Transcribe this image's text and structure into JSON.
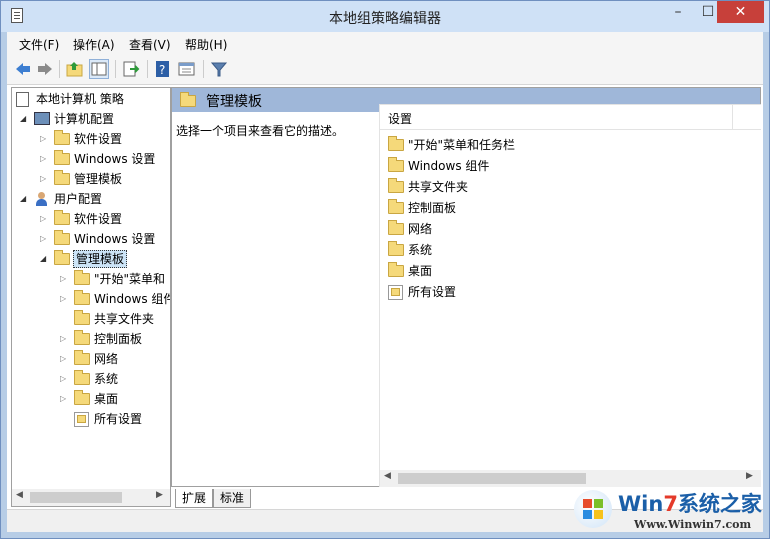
{
  "window": {
    "title": "本地组策略编辑器",
    "minimize": "–",
    "maximize": "☐",
    "close": "✕"
  },
  "menu": [
    "文件(F)",
    "操作(A)",
    "查看(V)",
    "帮助(H)"
  ],
  "toolbar": [
    "back-icon",
    "forward-icon",
    "up-folder-icon",
    "show-hide-tree-icon",
    "export-list-icon",
    "help-icon",
    "properties-icon",
    "filter-icon"
  ],
  "tree": {
    "root": "本地计算机 策略",
    "computer_config": "计算机配置",
    "user_config": "用户配置",
    "items": {
      "software": "软件设置",
      "windows_settings": "Windows 设置",
      "admin_templates": "管理模板",
      "start_menu": "\"开始\"菜单和",
      "windows_components": "Windows 组件",
      "shared_folders": "共享文件夹",
      "control_panel": "控制面板",
      "network": "网络",
      "system": "系统",
      "desktop": "桌面",
      "all_settings": "所有设置"
    }
  },
  "detail": {
    "header": "管理模板",
    "description": "选择一个项目来查看它的描述。",
    "column": "设置",
    "items": [
      "\"开始\"菜单和任务栏",
      "Windows 组件",
      "共享文件夹",
      "控制面板",
      "网络",
      "系统",
      "桌面",
      "所有设置"
    ]
  },
  "tabs": [
    "扩展",
    "标准"
  ],
  "watermark": {
    "title_a": "Win",
    "title_7": "7",
    "title_b": "系统之家",
    "url": "Www.Winwin7.com"
  }
}
